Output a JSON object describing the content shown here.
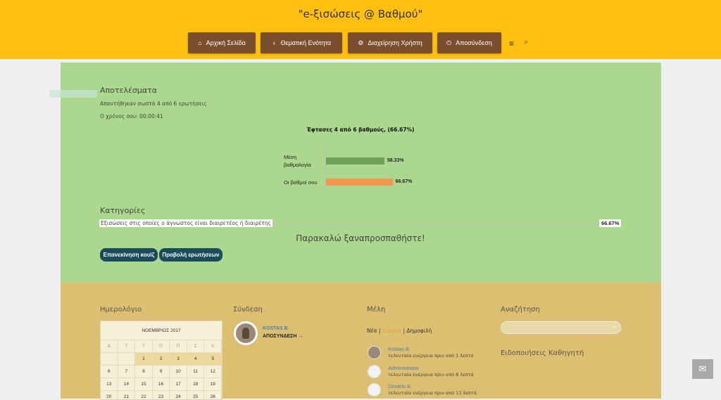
{
  "site": {
    "title": "\"e-ξισώσεις @ Βαθμού\""
  },
  "nav": {
    "items": [
      {
        "label": "Αρχική Σελίδα",
        "icon": "home-icon",
        "glyph": "⌂"
      },
      {
        "label": "Θεματική Ενότητα",
        "icon": "lightbulb-icon",
        "glyph": "♁"
      },
      {
        "label": "Διαχείρηση Χρήστη",
        "icon": "gears-icon",
        "glyph": "⚙"
      },
      {
        "label": "Αποσύνδεση",
        "icon": "power-icon",
        "glyph": "⏻"
      }
    ],
    "menu_glyph": "≡",
    "search_glyph": "⌕"
  },
  "results": {
    "title": "Αποτελέσματα",
    "correct_text": "Απαντήθηκαν σωστά 4 από 6 ερωτήσεις",
    "time_text": "Ο χρόνος σου: 00:00:41",
    "score_title": "Έφτασες 4 από 6 βαθμούς, (66.67%)"
  },
  "chart_data": {
    "type": "bar",
    "orientation": "horizontal",
    "categories": [
      "Μέση βαθμολογία",
      "Οι βαθμοί σου"
    ],
    "values": [
      58.33,
      66.67
    ],
    "value_labels": [
      "58.33%",
      "66.67%"
    ],
    "colors": [
      "#6fa257",
      "#f2974d"
    ],
    "xlim": [
      0,
      100
    ]
  },
  "categories": {
    "title": "Κατηγορίες",
    "items": [
      {
        "name": "Εξισώσεις στις οποίες ο άγνωστος είναι διαιρετέος ή διαιρέτης",
        "score": "66.67%"
      }
    ]
  },
  "retry_text": "Παρακαλώ ξαναπροσπαθήστε!",
  "buttons": {
    "restart": "Επανεκίνηση κουίζ",
    "view_questions": "Προβολή ερωτήσεων"
  },
  "footer": {
    "calendar": {
      "title": "Ημερολόγιο",
      "month": "ΝΟΕΜΒΡΙΟΣ 2017",
      "weekdays": [
        "Δ",
        "Τ",
        "Τ",
        "Π",
        "Π",
        "Σ",
        "Κ"
      ],
      "rows": [
        [
          "",
          "",
          "1",
          "2",
          "3",
          "4",
          "5"
        ],
        [
          "6",
          "7",
          "8",
          "9",
          "10",
          "11",
          "12"
        ],
        [
          "13",
          "14",
          "15",
          "16",
          "17",
          "18",
          "19"
        ],
        [
          "20",
          "21",
          "22",
          "23",
          "24",
          "25",
          "26"
        ]
      ]
    },
    "login": {
      "title": "Σύνδεση",
      "user": "KOSTAS B.",
      "logout": "ΑΠΟΣΥΝΔΕΣΗ →"
    },
    "members": {
      "title": "Μέλη",
      "filters": [
        "Νέα",
        "Ενεργά",
        "Δημοφιλή"
      ],
      "separator": "|",
      "list": [
        {
          "name": "Kostas B.",
          "activity": "τελευταία ενέργεια πριν από 1 λεπτό"
        },
        {
          "name": "Administrator",
          "activity": "τελευταία ενέργεια πριν από 8 λεπτά"
        },
        {
          "name": "Dimitris B.",
          "activity": "τελευταία ενέργεια πριν από 13 λεπτά"
        }
      ]
    },
    "search": {
      "title": "Αναζήτηση",
      "placeholder": "",
      "glyph": "⌕"
    },
    "teacher_notes": {
      "title": "Ειδοποιήσεις Καθηγητή"
    }
  },
  "scroll_top": {
    "glyph": "✉"
  }
}
